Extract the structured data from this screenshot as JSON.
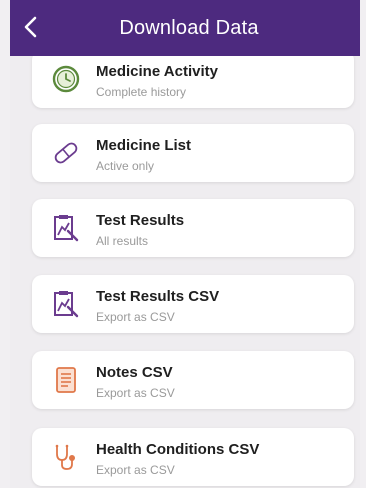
{
  "header": {
    "title": "Download Data"
  },
  "icons": {
    "back": "chevron-left-icon"
  },
  "colors": {
    "header": "#4d2a7f",
    "purple_icon": "#6b3c8f",
    "green_icon": "#5c8a3c",
    "orange_icon": "#e0784a"
  },
  "items": [
    {
      "label": "Medicine Activity",
      "subtitle": "Complete history",
      "icon": "clock-icon"
    },
    {
      "label": "Medicine List",
      "subtitle": "Active only",
      "icon": "pill-icon"
    },
    {
      "label": "Test Results",
      "subtitle": "All results",
      "icon": "lab-report-icon"
    },
    {
      "label": "Test Results CSV",
      "subtitle": "Export as CSV",
      "icon": "lab-report-icon"
    },
    {
      "label": "Notes CSV",
      "subtitle": "Export as CSV",
      "icon": "notes-icon"
    },
    {
      "label": "Health Conditions CSV",
      "subtitle": "Export as CSV",
      "icon": "stethoscope-icon"
    }
  ]
}
